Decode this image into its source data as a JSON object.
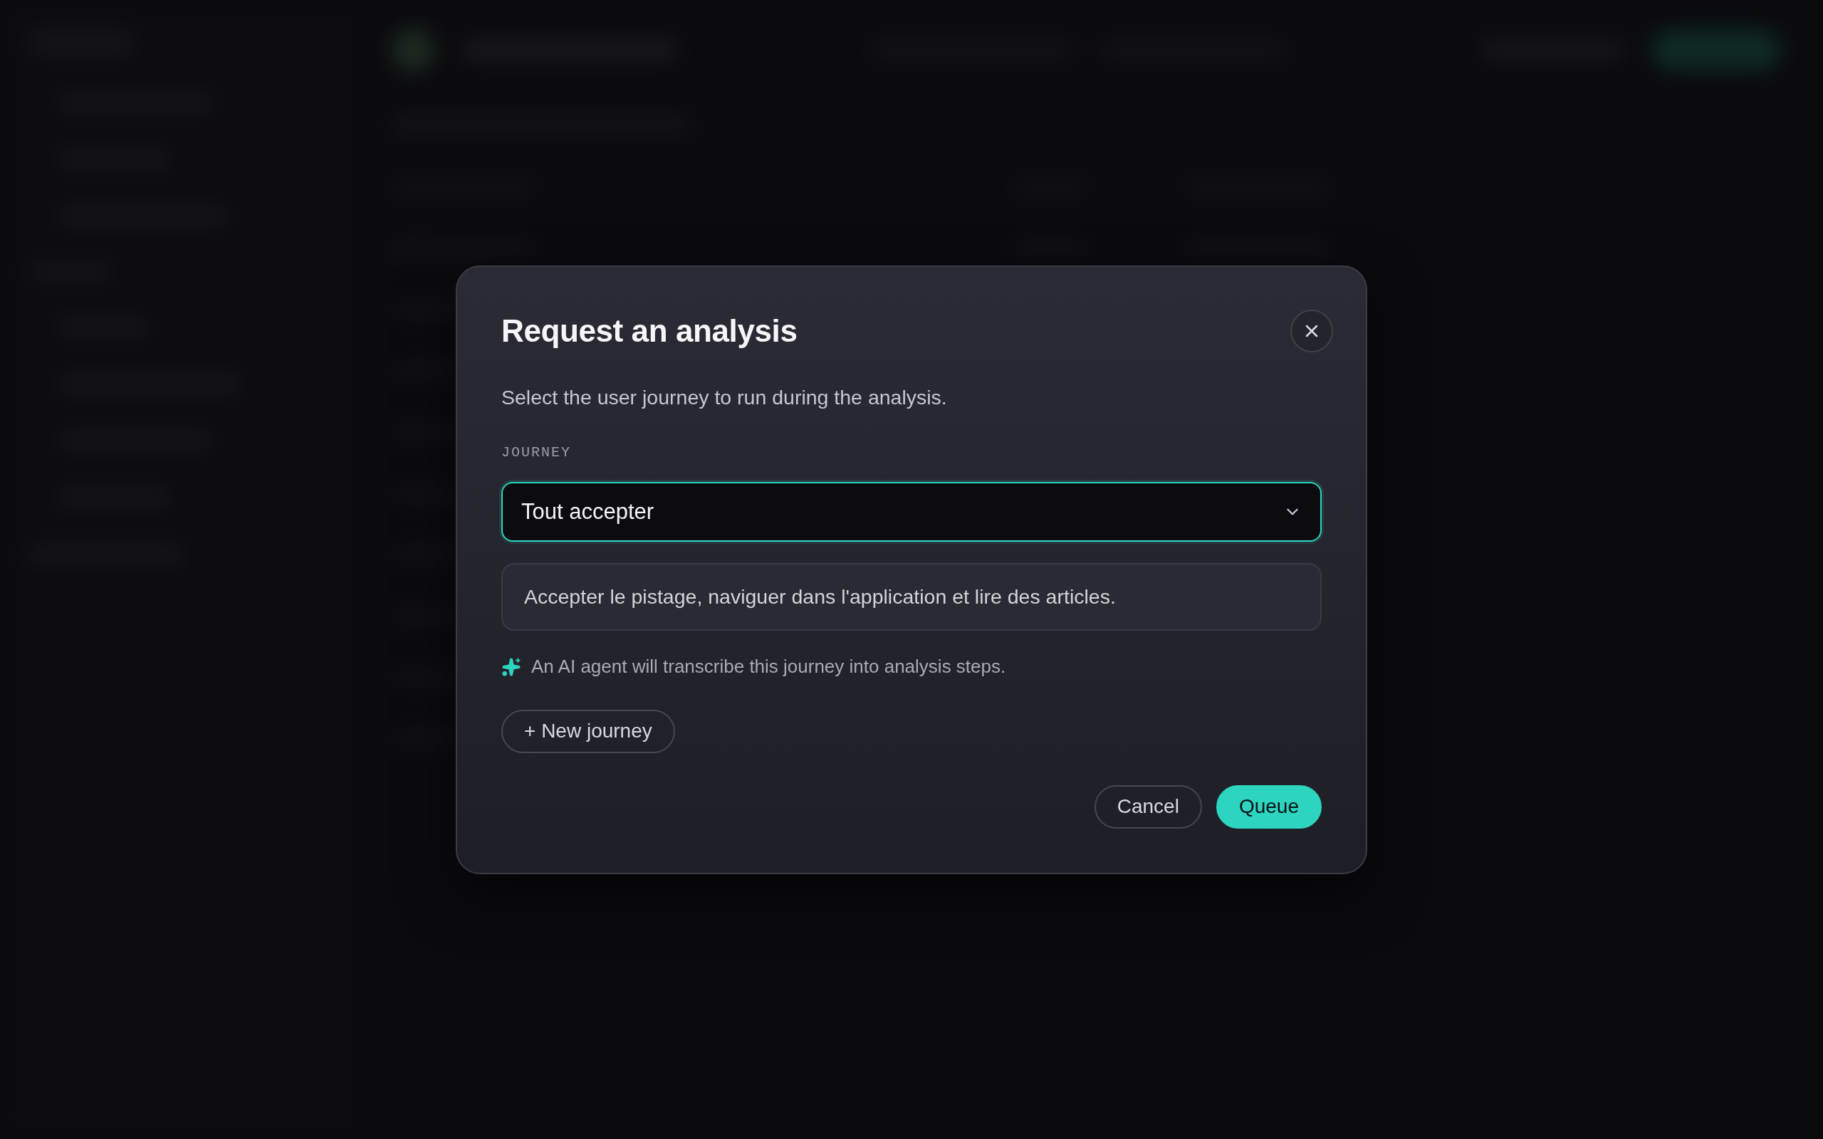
{
  "dialog": {
    "title": "Request an analysis",
    "subtitle": "Select the user journey to run during the analysis.",
    "journey_field": {
      "label": "JOURNEY",
      "value": "Tout accepter",
      "focused": true
    },
    "journey_description": "Accepter le pistage, naviguer dans l'application et lire des articles.",
    "ai_note": "An AI agent will transcribe this journey into analysis steps.",
    "new_journey_button": "+ New journey",
    "actions": [
      {
        "label": "Cancel",
        "kind": "secondary"
      },
      {
        "label": "Queue",
        "kind": "primary"
      }
    ]
  }
}
